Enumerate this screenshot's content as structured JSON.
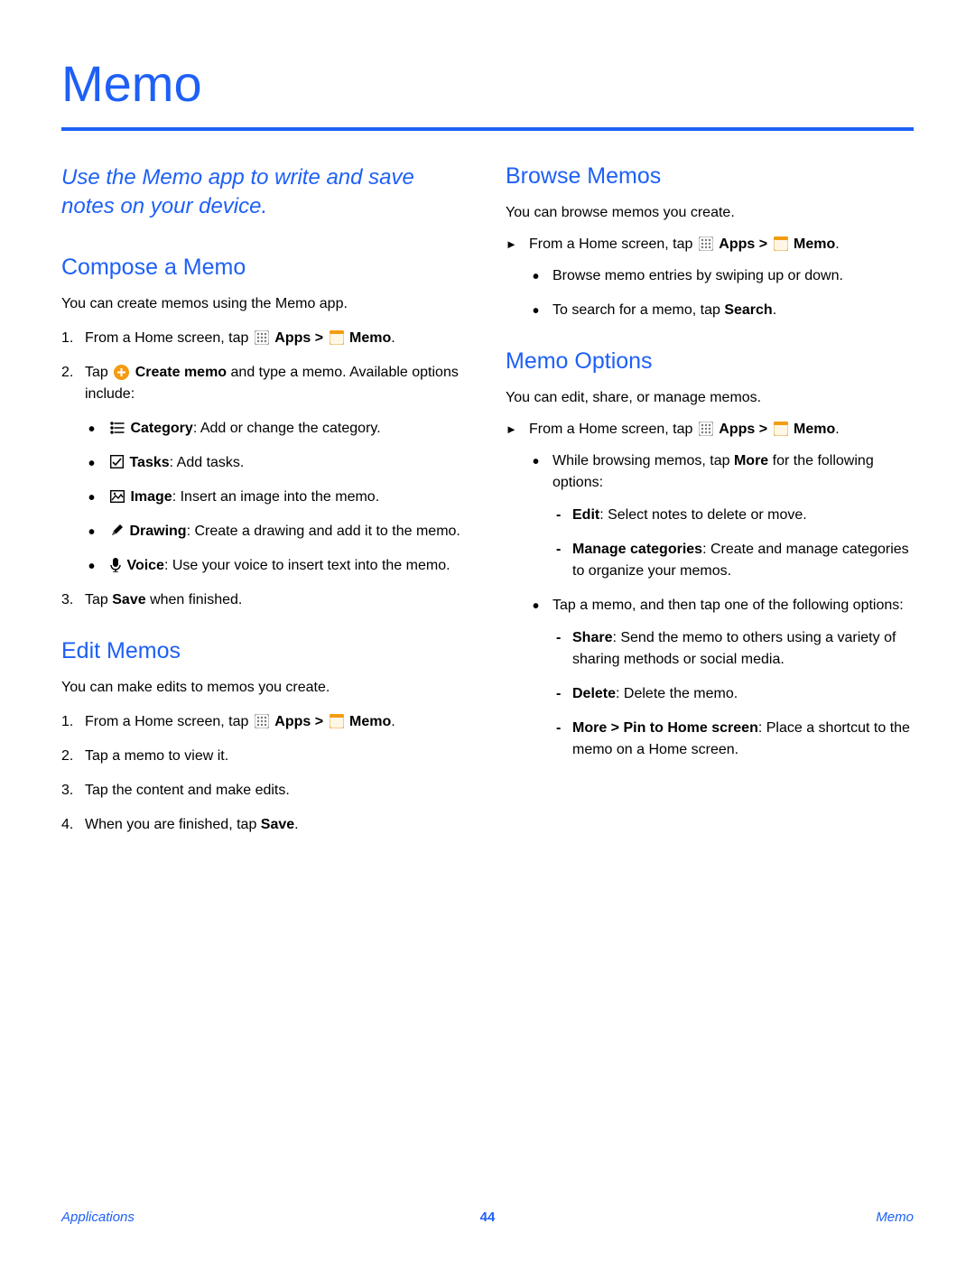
{
  "title": "Memo",
  "intro": "Use the Memo app to write and save notes on your device.",
  "nav": {
    "apps": "Apps",
    "memo": "Memo",
    "sep": " > "
  },
  "compose": {
    "heading": "Compose a Memo",
    "lead": "You can create memos using the Memo app.",
    "step1_pre": "From a Home screen, tap ",
    "step2_pre": "Tap ",
    "step2_create": "Create memo",
    "step2_post": " and type a memo. Available options include:",
    "opts": {
      "category_b": "Category",
      "category_t": ": Add or change the category.",
      "tasks_b": "Tasks",
      "tasks_t": ": Add tasks.",
      "image_b": "Image",
      "image_t": ": Insert an image into the memo.",
      "drawing_b": "Drawing",
      "drawing_t": ": Create a drawing and add it to the memo.",
      "voice_b": "Voice",
      "voice_t": ": Use your voice to insert text into the memo."
    },
    "step3_pre": "Tap ",
    "step3_b": "Save",
    "step3_post": " when finished."
  },
  "edit": {
    "heading": "Edit Memos",
    "lead": "You can make edits to memos you create.",
    "step1_pre": "From a Home screen, tap ",
    "step2": "Tap a memo to view it.",
    "step3": "Tap the content and make edits.",
    "step4_pre": "When you are finished, tap ",
    "step4_b": "Save",
    "step4_post": "."
  },
  "browse": {
    "heading": "Browse Memos",
    "lead": "You can browse memos you create.",
    "step1_pre": "From a Home screen, tap ",
    "b1": "Browse memo entries by swiping up or down.",
    "b2_pre": "To search for a memo, tap ",
    "b2_b": "Search",
    "b2_post": "."
  },
  "options": {
    "heading": "Memo Options",
    "lead": "You can edit, share, or manage memos.",
    "step1_pre": "From a Home screen, tap ",
    "b1_pre": "While browsing memos, tap ",
    "b1_b": "More",
    "b1_post": " for the following options:",
    "d_edit_b": "Edit",
    "d_edit_t": ": Select notes to delete or move.",
    "d_mgr_b": "Manage categories",
    "d_mgr_t": ": Create and manage categories to organize your memos.",
    "b2": "Tap a memo, and then tap one of the following options:",
    "d_share_b": "Share",
    "d_share_t": ": Send the memo to others using a variety of sharing methods or social media.",
    "d_del_b": "Delete",
    "d_del_t": ": Delete the memo.",
    "d_more_b": "More > Pin to Home screen",
    "d_more_t": ": Place a shortcut to the memo on a Home screen."
  },
  "footer": {
    "left": "Applications",
    "center": "44",
    "right": "Memo"
  }
}
